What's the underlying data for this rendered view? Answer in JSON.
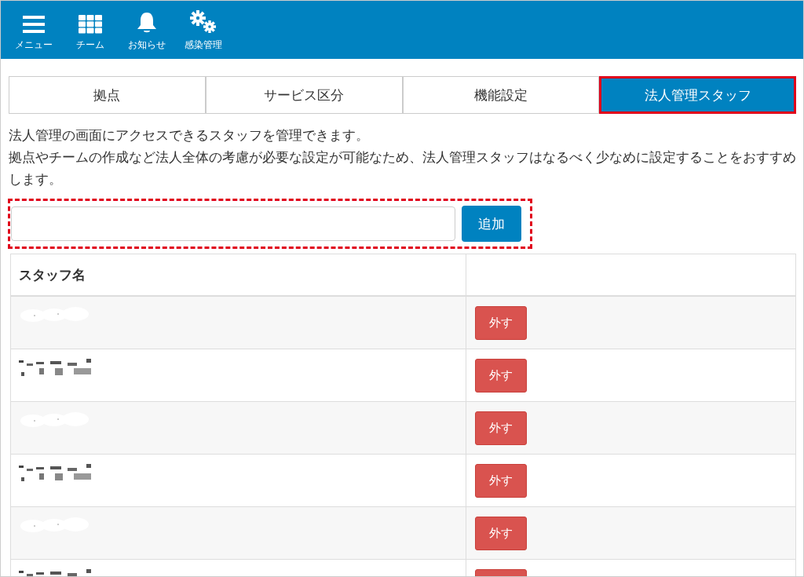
{
  "nav": [
    {
      "kind": "menu",
      "label": "メニュー"
    },
    {
      "kind": "grid",
      "label": "チーム"
    },
    {
      "kind": "bell",
      "label": "お知らせ"
    },
    {
      "kind": "gears",
      "label": "感染管理"
    }
  ],
  "tabs": [
    {
      "label": "拠点",
      "selected": false,
      "outlined": false
    },
    {
      "label": "サービス区分",
      "selected": false,
      "outlined": false
    },
    {
      "label": "機能設定",
      "selected": false,
      "outlined": false
    },
    {
      "label": "法人管理スタッフ",
      "selected": true,
      "outlined": true
    }
  ],
  "description": [
    "法人管理の画面にアクセスできるスタッフを管理できます。",
    "拠点やチームの作成など法人全体の考慮が必要な設定が可能なため、法人管理スタッフはなるべく少なめに設定することをおすすめします。"
  ],
  "add_form": {
    "outlined": true,
    "button": "追加"
  },
  "table": {
    "columns": [
      "スタッフ名"
    ],
    "rows": [
      {
        "kind": "full",
        "button": "外す"
      },
      {
        "kind": "full",
        "button": "外す"
      },
      {
        "kind": "full",
        "button": "外す"
      },
      {
        "kind": "full",
        "button": "外す"
      },
      {
        "kind": "full",
        "button": "外す"
      },
      {
        "kind": "cut"
      }
    ]
  }
}
